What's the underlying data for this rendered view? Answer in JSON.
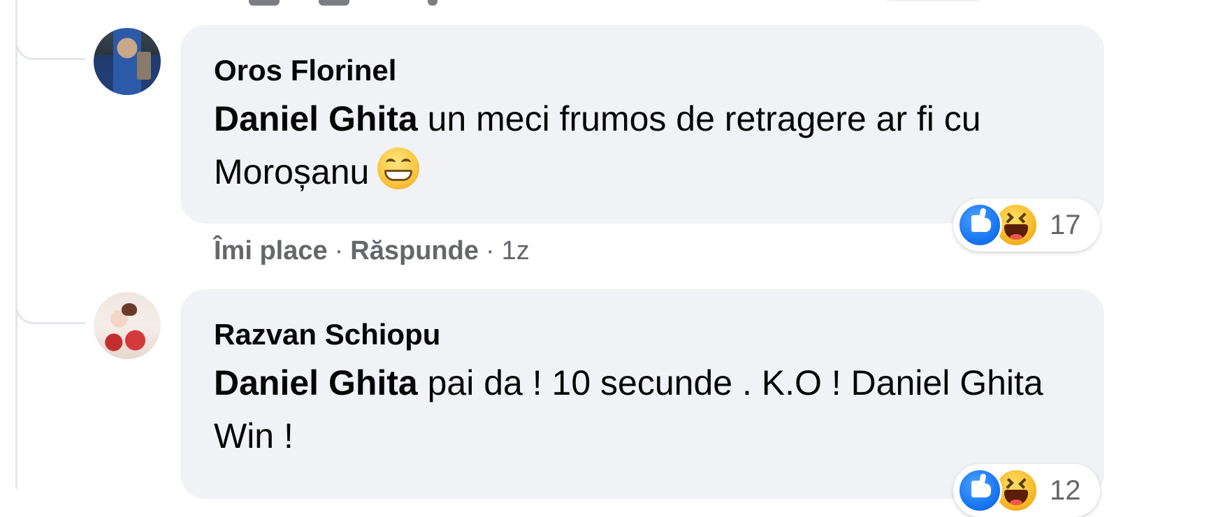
{
  "comments": [
    {
      "author": "Oros Florinel",
      "mention": "Daniel Ghita",
      "text": " un meci frumos de retragere ar fi cu Moroșanu",
      "emoji": "grinning-face-icon",
      "reaction_count": "17",
      "actions": {
        "like_label": "Îmi place",
        "reply_label": "Răspunde",
        "separator": "·",
        "time": "1z"
      }
    },
    {
      "author": "Razvan Schiopu",
      "mention": "Daniel Ghita",
      "text": " pai da ! 10 secunde . K.O ! Daniel Ghita Win !",
      "reaction_count": "12"
    }
  ],
  "reaction_types": [
    "like-icon",
    "haha-icon"
  ],
  "colors": {
    "bubble_bg": "#f0f2f5",
    "secondary_text": "#65676b",
    "like_blue": "#1877f2",
    "haha_yellow": "#f7b928"
  }
}
